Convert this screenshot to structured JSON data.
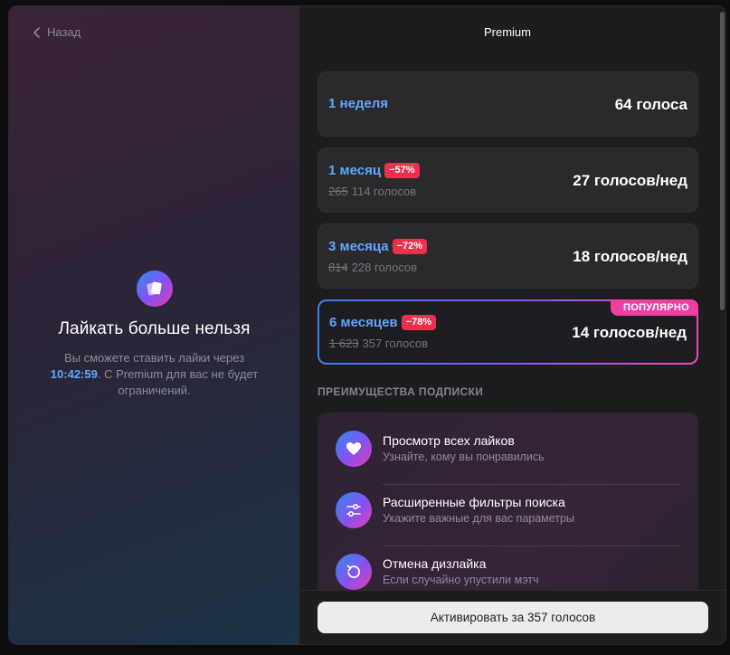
{
  "back_label": "Назад",
  "left": {
    "title": "Лайкать больше нельзя",
    "desc_before": "Вы сможете ставить лайки через",
    "time": "10:42:59",
    "desc_after": ". С Premium для вас не будет ограничений."
  },
  "header": {
    "title": "Premium"
  },
  "plans": [
    {
      "name": "1 неделя",
      "price": "64 голоса"
    },
    {
      "name": "1 месяц",
      "discount": "−57%",
      "old_price": "265",
      "new_total": "114 голосов",
      "price": "27 голосов/нед"
    },
    {
      "name": "3 месяца",
      "discount": "−72%",
      "old_price": "814",
      "new_total": "228 голосов",
      "price": "18 голосов/нед"
    },
    {
      "name": "6 месяцев",
      "discount": "−78%",
      "old_price": "1 623",
      "new_total": "357 голосов",
      "price": "14 голосов/нед",
      "tag": "ПОПУЛЯРНО",
      "selected": true
    }
  ],
  "benefits_title": "ПРЕИМУЩЕСТВА ПОДПИСКИ",
  "benefits": [
    {
      "title": "Просмотр всех лайков",
      "subtitle": "Узнайте, кому вы понравились",
      "icon": "heart-icon"
    },
    {
      "title": "Расширенные фильтры поиска",
      "subtitle": "Укажите важные для вас параметры",
      "icon": "filters-icon"
    },
    {
      "title": "Отмена дизлайка",
      "subtitle": "Если случайно упустили мэтч",
      "icon": "undo-icon"
    }
  ],
  "footer": {
    "activate_label": "Активировать за 357 голосов"
  },
  "colors": {
    "accent_blue": "#62a6ff",
    "discount_red": "#ee2f4b",
    "popular_pink": "#f03fa2"
  }
}
